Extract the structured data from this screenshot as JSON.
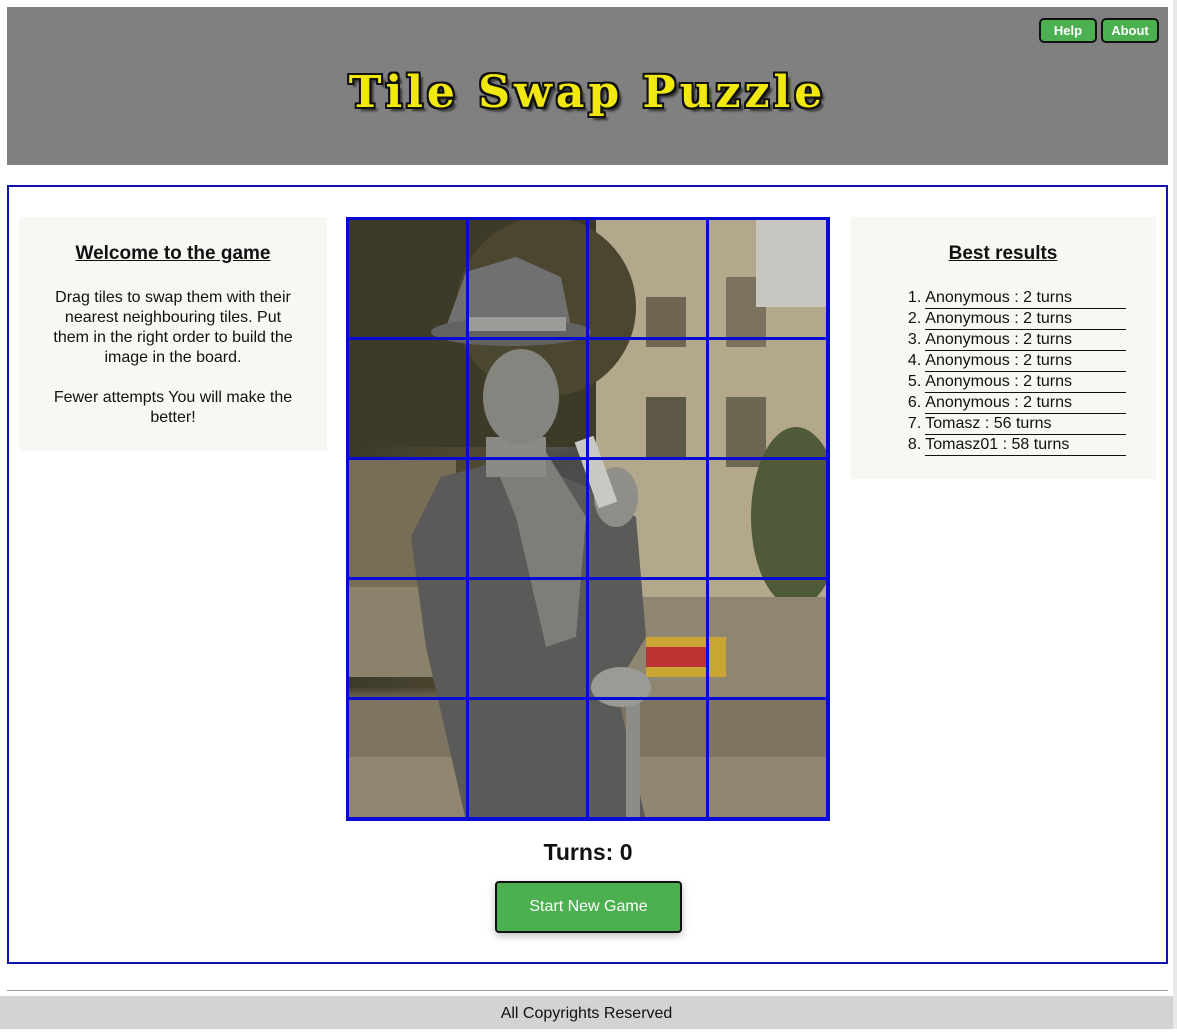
{
  "header": {
    "title": "Tile Swap Puzzle",
    "help_label": "Help",
    "about_label": "About"
  },
  "welcome": {
    "heading": "Welcome to the game",
    "paragraph1": "Drag tiles to swap them with their nearest neighbouring tiles. Put them in the right order to build the image in the board.",
    "paragraph2": "Fewer attempts You will make the better!"
  },
  "best_results": {
    "heading": "Best results",
    "entries": [
      {
        "rank": "1.",
        "text": "Anonymous : 2 turns"
      },
      {
        "rank": "2.",
        "text": "Anonymous : 2 turns"
      },
      {
        "rank": "3.",
        "text": "Anonymous : 2 turns"
      },
      {
        "rank": "4.",
        "text": "Anonymous : 2 turns"
      },
      {
        "rank": "5.",
        "text": "Anonymous : 2 turns"
      },
      {
        "rank": "6.",
        "text": "Anonymous : 2 turns"
      },
      {
        "rank": "7.",
        "text": "Tomasz : 56 turns"
      },
      {
        "rank": "8.",
        "text": "Tomasz01 : 58 turns"
      }
    ]
  },
  "board": {
    "columns": 4,
    "rows": 5,
    "grid_color": "#0a0ad8",
    "image_subject": "man in top hat and coat holding a pipe, street background"
  },
  "status": {
    "turns_text": "Turns: 0"
  },
  "controls": {
    "start_label": "Start New Game",
    "button_color": "#4caf50"
  },
  "footer": {
    "text": "All Copyrights Reserved"
  }
}
